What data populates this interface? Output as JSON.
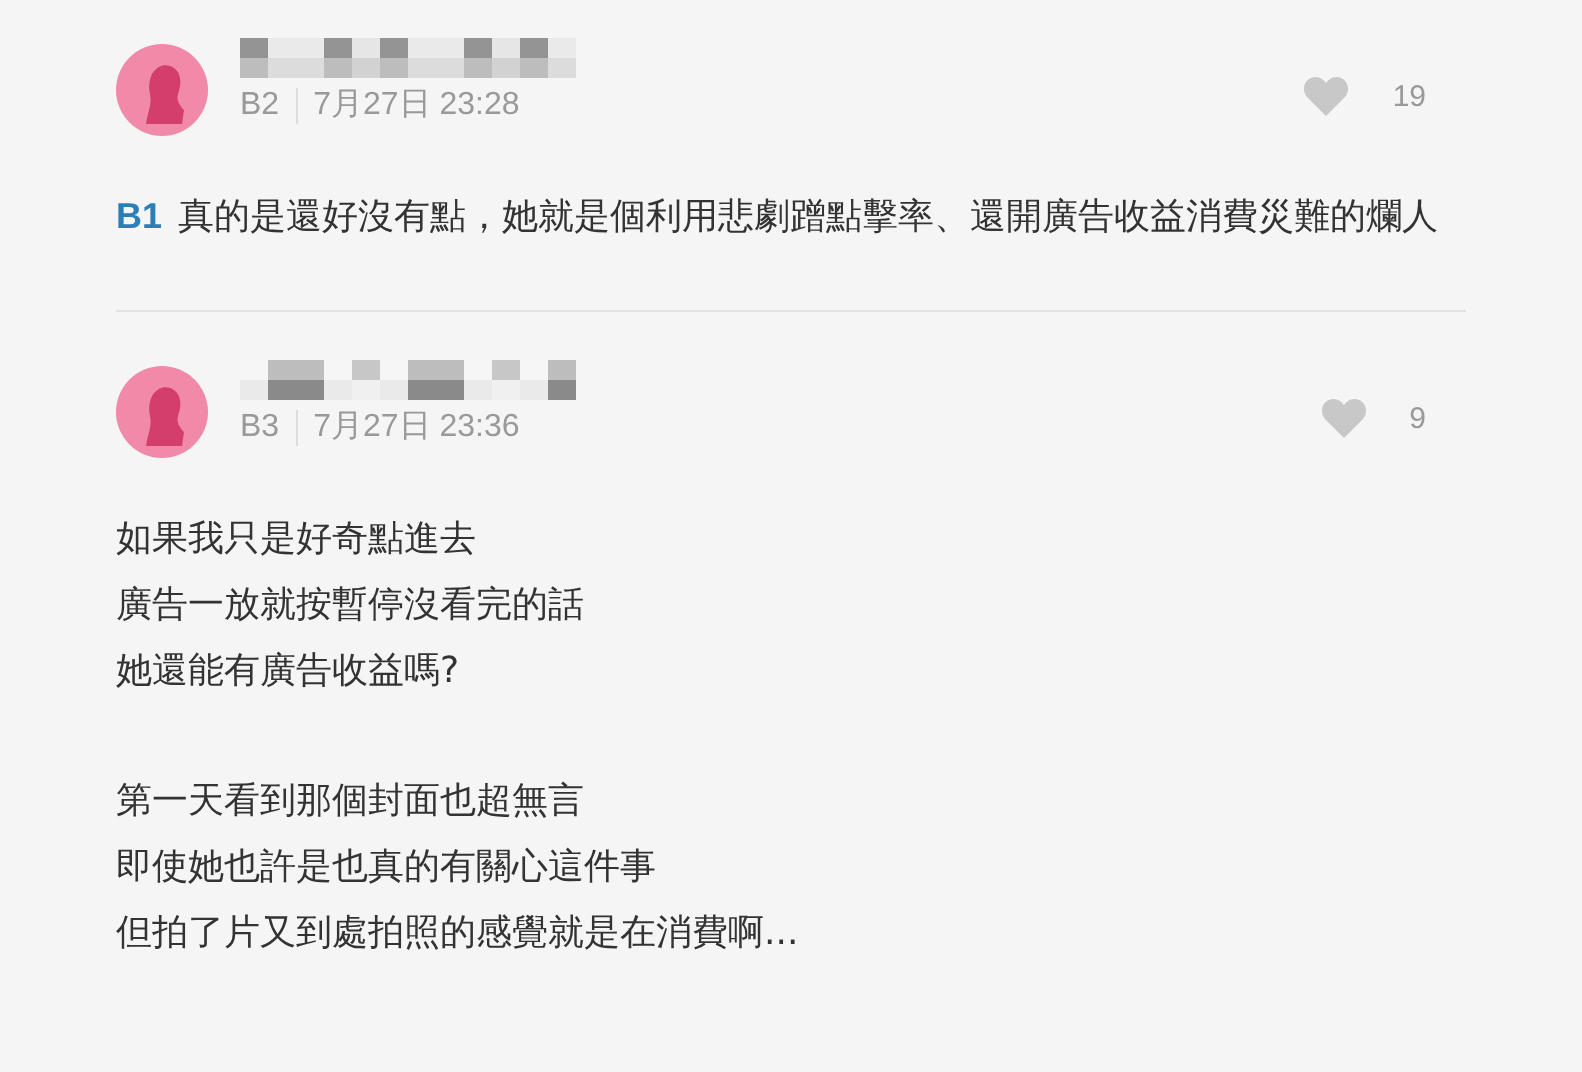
{
  "comments": [
    {
      "name_redacted": true,
      "floor": "B2",
      "time": "7月27日 23:28",
      "liked": false,
      "likes": "19",
      "reply_to": "B1",
      "paragraphs": [
        [
          "真的是還好沒有點，她就是個利用悲劇蹭點擊率、還開廣告收益消費災難的爛人"
        ]
      ]
    },
    {
      "name_redacted": true,
      "floor": "B3",
      "time": "7月27日 23:36",
      "liked": false,
      "likes": "9",
      "paragraphs": [
        [
          "如果我只是好奇點進去",
          "廣告一放就按暫停沒看完的話",
          "她還能有廣告收益嗎?"
        ],
        [
          "第一天看到那個封面也超無言",
          "即使她也許是也真的有關心這件事",
          "但拍了片又到處拍照的感覺就是在消費啊..."
        ]
      ]
    }
  ]
}
